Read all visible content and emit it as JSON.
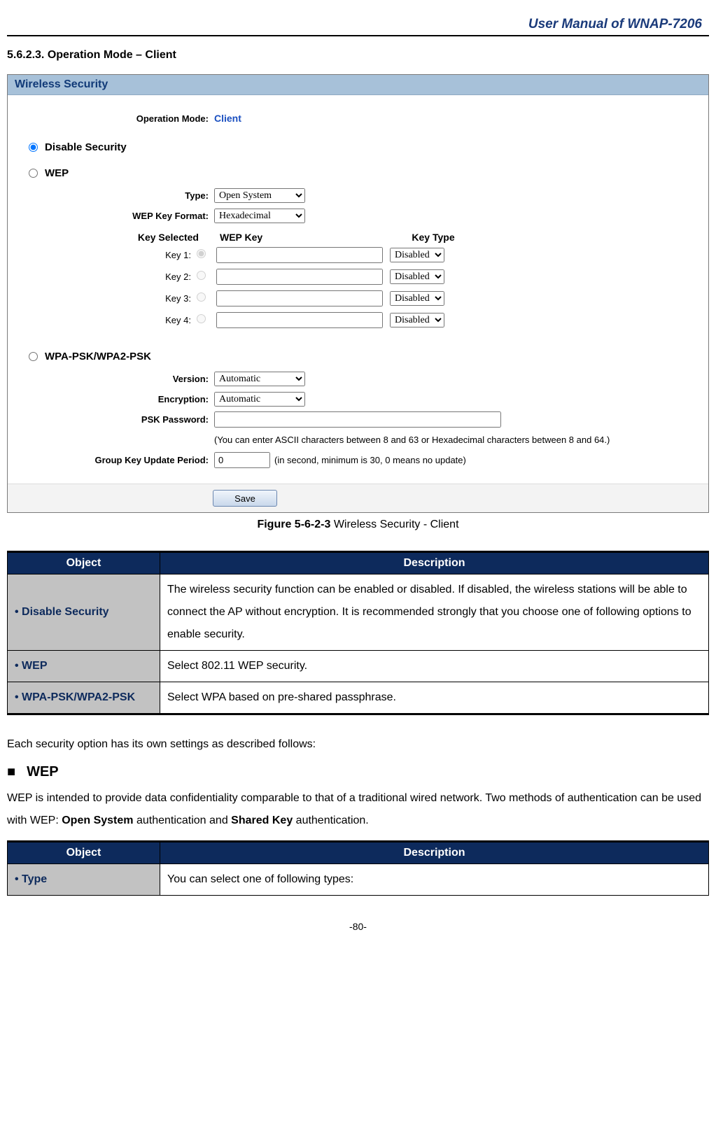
{
  "header": {
    "doc_title": "User Manual of WNAP-7206"
  },
  "section": {
    "number": "5.6.2.3.",
    "title": "Operation Mode – Client"
  },
  "figure": {
    "panel_title": "Wireless Security",
    "op_mode_label": "Operation Mode:",
    "op_mode_value": "Client",
    "disable_label": "Disable Security",
    "wep_label": "WEP",
    "wep": {
      "type_label": "Type:",
      "type_value": "Open System",
      "format_label": "WEP Key Format:",
      "format_value": "Hexadecimal",
      "head_selected": "Key Selected",
      "head_key": "WEP Key",
      "head_type": "Key Type",
      "keys": [
        {
          "label": "Key 1:",
          "type": "Disabled"
        },
        {
          "label": "Key 2:",
          "type": "Disabled"
        },
        {
          "label": "Key 3:",
          "type": "Disabled"
        },
        {
          "label": "Key 4:",
          "type": "Disabled"
        }
      ]
    },
    "wpa_label": "WPA-PSK/WPA2-PSK",
    "wpa": {
      "version_label": "Version:",
      "version_value": "Automatic",
      "enc_label": "Encryption:",
      "enc_value": "Automatic",
      "psk_label": "PSK Password:",
      "psk_hint": "(You can enter ASCII characters between 8 and 63 or Hexadecimal characters between 8 and 64.)",
      "gkup_label": "Group Key Update Period:",
      "gkup_value": "0",
      "gkup_hint": "(in second, minimum is 30, 0 means no update)"
    },
    "save_label": "Save",
    "caption_bold": "Figure 5-6-2-3",
    "caption_rest": " Wireless Security - Client"
  },
  "table1": {
    "h_object": "Object",
    "h_desc": "Description",
    "rows": [
      {
        "obj": "Disable Security",
        "desc": "The wireless security function can be enabled or disabled. If disabled, the wireless stations will be able to connect the AP without encryption. It is recommended strongly that you choose one of following options to enable security."
      },
      {
        "obj": "WEP",
        "desc": "Select 802.11 WEP security."
      },
      {
        "obj": "WPA-PSK/WPA2-PSK",
        "desc": "Select WPA based on pre-shared passphrase."
      }
    ]
  },
  "body": {
    "intro": "Each security option has its own settings as described follows:",
    "wep_title": "WEP",
    "wep_desc_a": "WEP is intended to provide data confidentiality comparable to that of a traditional wired network. Two methods of authentication can be used with WEP: ",
    "wep_desc_b": "Open System",
    "wep_desc_c": " authentication and ",
    "wep_desc_d": "Shared Key",
    "wep_desc_e": " authentication."
  },
  "table2": {
    "h_object": "Object",
    "h_desc": "Description",
    "row": {
      "obj": "Type",
      "desc": "You can select one of following types:"
    }
  },
  "footer": {
    "page": "-80-"
  }
}
